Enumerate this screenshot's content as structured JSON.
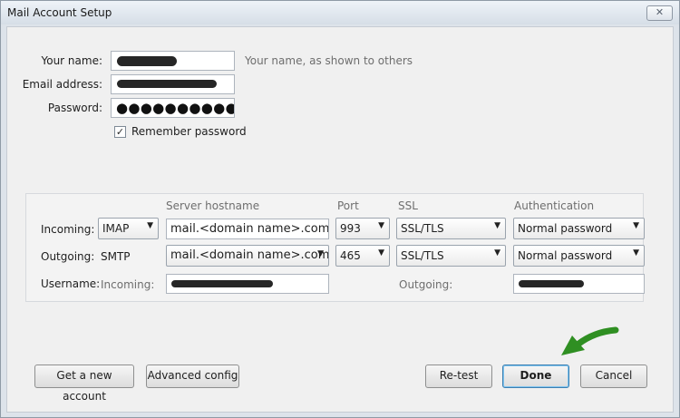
{
  "window": {
    "title": "Mail Account Setup",
    "close_glyph": "✕"
  },
  "identity": {
    "name_label": "Your name:",
    "name_hint": "Your name, as shown to others",
    "email_label": "Email address:",
    "password_label": "Password:",
    "password_mask": "●●●●●●●●●●●●●●●",
    "remember_label": "Remember password",
    "remember_checked": true,
    "check_glyph": "✓"
  },
  "server": {
    "headers": {
      "hostname": "Server hostname",
      "port": "Port",
      "ssl": "SSL",
      "auth": "Authentication"
    },
    "incoming": {
      "label": "Incoming:",
      "protocol": "IMAP",
      "hostname": "mail.<domain name>.com",
      "port": "993",
      "ssl": "SSL/TLS",
      "auth": "Normal password"
    },
    "outgoing": {
      "label": "Outgoing:",
      "protocol": "SMTP",
      "hostname": "mail.<domain name>.com",
      "port": "465",
      "ssl": "SSL/TLS",
      "auth": "Normal password"
    },
    "username": {
      "label": "Username:",
      "incoming_label": "Incoming:",
      "outgoing_label": "Outgoing:"
    }
  },
  "buttons": {
    "new_account": "Get a new account",
    "advanced": "Advanced config",
    "retest": "Re-test",
    "done": "Done",
    "cancel": "Cancel"
  },
  "icons": {
    "dropdown": "chevron-down-icon",
    "annotation": "green-arrow-icon"
  },
  "colors": {
    "annotation_arrow": "#2f8f22",
    "default_button_border": "#3c7fb1"
  }
}
